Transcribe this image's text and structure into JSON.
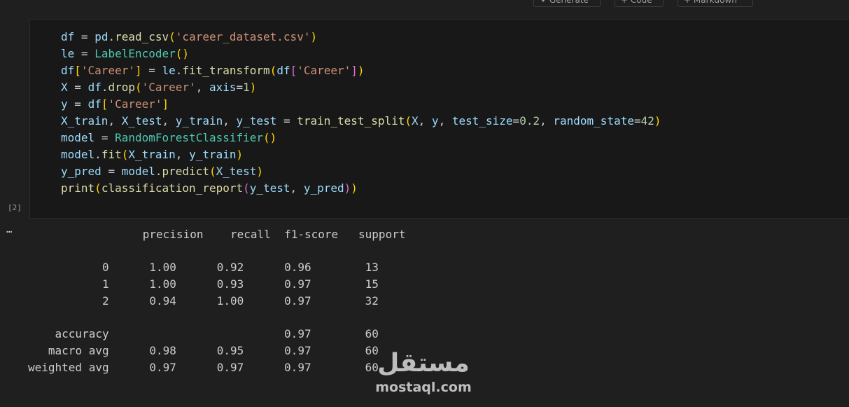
{
  "toolbar": {
    "generate_label": "✦ Generate",
    "code_label": "+ Code",
    "markdown_label": "+ Markdown"
  },
  "cell": {
    "execution_count": "[2]",
    "code_lines": [
      "df = pd.read_csv('career_dataset.csv')",
      "le = LabelEncoder()",
      "df['Career'] = le.fit_transform(df['Career'])",
      "X = df.drop('Career', axis=1)",
      "y = df['Career']",
      "X_train, X_test, y_train, y_test = train_test_split(X, y, test_size=0.2, random_state=42)",
      "model = RandomForestClassifier()",
      "model.fit(X_train, y_train)",
      "y_pred = model.predict(X_test)",
      "print(classification_report(y_test, y_pred))"
    ]
  },
  "output": {
    "ellipsis": "…",
    "columns": [
      "precision",
      "recall",
      "f1-score",
      "support"
    ],
    "rows": [
      {
        "label": "0",
        "values": [
          "1.00",
          "0.92",
          "0.96",
          "13"
        ]
      },
      {
        "label": "1",
        "values": [
          "1.00",
          "0.93",
          "0.97",
          "15"
        ]
      },
      {
        "label": "2",
        "values": [
          "0.94",
          "1.00",
          "0.97",
          "32"
        ]
      },
      {
        "label": "accuracy",
        "values": [
          "",
          "",
          "0.97",
          "60"
        ]
      },
      {
        "label": "macro avg",
        "values": [
          "0.98",
          "0.95",
          "0.97",
          "60"
        ]
      },
      {
        "label": "weighted avg",
        "values": [
          "0.97",
          "0.97",
          "0.97",
          "60"
        ]
      }
    ]
  },
  "watermark": {
    "arabic": "مستقل",
    "latin": "mostaql.com"
  },
  "colors": {
    "background": "#1f1f1f",
    "cell_background": "#181818",
    "text": "#cccccc",
    "variable": "#9cdcfe",
    "string": "#ce9178",
    "class": "#4ec9b0",
    "function": "#dcdcaa",
    "number": "#b5cea8",
    "bracket_gold": "#ffd700",
    "bracket_pink": "#da70d6",
    "bracket_blue": "#179fff"
  }
}
